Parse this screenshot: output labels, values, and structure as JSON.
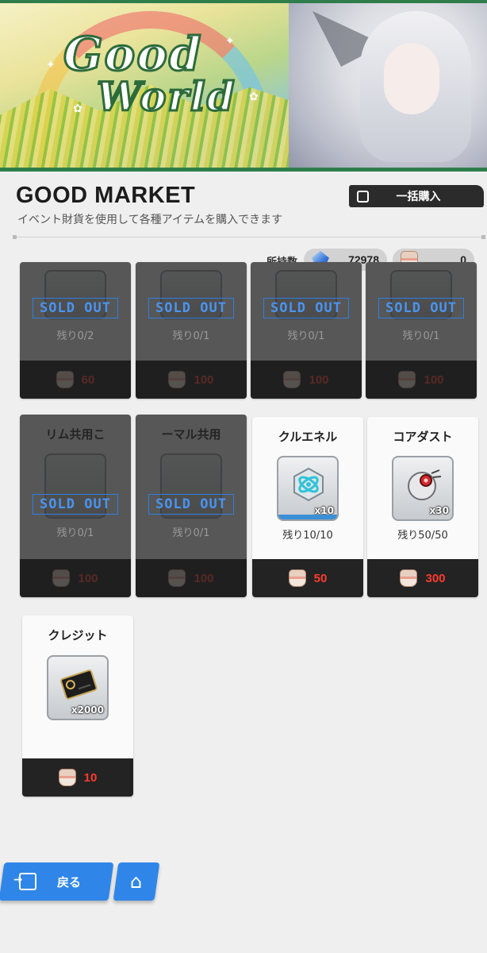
{
  "banner": {
    "logo_line1": "Good",
    "logo_line2": "World"
  },
  "header": {
    "title": "GOOD MARKET",
    "subtitle": "イベント財貨を使用して各種アイテムを購入できます",
    "bulk_purchase_label": "一括購入"
  },
  "currency": {
    "owned_label": "所持数",
    "gem_amount": "72978",
    "cake_amount": "0"
  },
  "sold_out_label": "SOLD OUT",
  "items": [
    {
      "name": "",
      "remaining": "残り0/2",
      "price": "60",
      "sold_out": true,
      "icon": "badge-icon"
    },
    {
      "name": "",
      "remaining": "残り0/1",
      "price": "100",
      "sold_out": true,
      "icon": "badge-icon"
    },
    {
      "name": "",
      "remaining": "残り0/1",
      "price": "100",
      "sold_out": true,
      "icon": "badge-icon"
    },
    {
      "name": "",
      "remaining": "残り0/1",
      "price": "100",
      "sold_out": true,
      "icon": "badge-icon"
    },
    {
      "name": "リム共用こ",
      "remaining": "残り0/1",
      "price": "100",
      "sold_out": true,
      "icon": "badge-icon"
    },
    {
      "name": "ーマル共用",
      "remaining": "残り0/1",
      "price": "100",
      "sold_out": true,
      "icon": "badge-icon"
    },
    {
      "name": "クルエネル",
      "remaining": "残り10/10",
      "price": "50",
      "quantity": "x10",
      "sold_out": false,
      "icon": "energy-core-icon"
    },
    {
      "name": "コアダスト",
      "remaining": "残り50/50",
      "price": "300",
      "quantity": "x30",
      "sold_out": false,
      "icon": "core-dust-icon"
    },
    {
      "name": "クレジット",
      "remaining": "",
      "price": "10",
      "quantity": "x2000",
      "sold_out": false,
      "icon": "credit-card-icon"
    }
  ],
  "nav": {
    "back_label": "戻る"
  },
  "colors": {
    "accent": "#2f86e8",
    "price_red": "#ff3b2f",
    "sold_out_blue": "#4a94f0",
    "banner_green": "#2e7d4a"
  }
}
